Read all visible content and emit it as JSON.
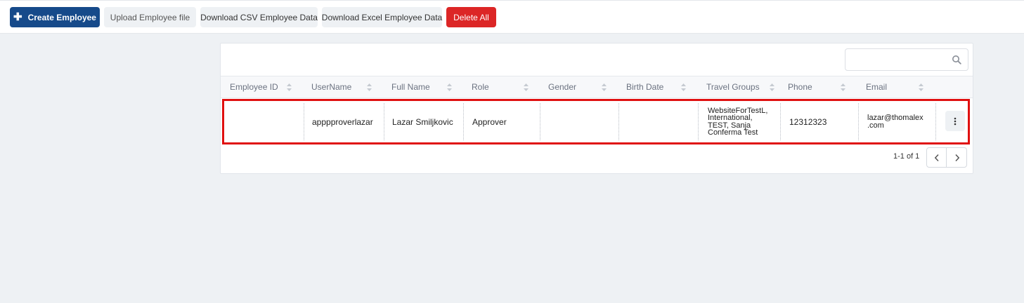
{
  "toolbar": {
    "create_label": "Create Employee",
    "upload_label": "Upload Employee file",
    "csv_label": "Download CSV Employee Data",
    "excel_label": "Download Excel Employee Data",
    "delete_label": "Delete All"
  },
  "search": {
    "value": "",
    "placeholder": ""
  },
  "table": {
    "columns": [
      "Employee ID",
      "UserName",
      "Full Name",
      "Role",
      "Gender",
      "Birth Date",
      "Travel Groups",
      "Phone",
      "Email"
    ],
    "rows": [
      {
        "employee_id": "",
        "username": "apppproverlazar",
        "full_name": "Lazar Smiljkovic",
        "role": "Approver",
        "gender": "",
        "birth_date": "",
        "travel_groups": [
          "WebsiteForTestL,",
          "International,",
          "TEST, Sanja",
          "Conferma Test"
        ],
        "phone": "12312323",
        "email": [
          "lazar@thomalex",
          ".com"
        ]
      }
    ]
  },
  "pagination": {
    "range": "1-1 of 1"
  },
  "colors": {
    "primary": "#164a8a",
    "danger": "#dc2626",
    "highlight": "#e01010",
    "background": "#eef1f4"
  },
  "icons": {
    "create": "plus-icon",
    "search": "search-icon",
    "sort": "sort-icon",
    "menu": "kebab-menu-icon",
    "prev": "chevron-left-icon",
    "next": "chevron-right-icon"
  }
}
